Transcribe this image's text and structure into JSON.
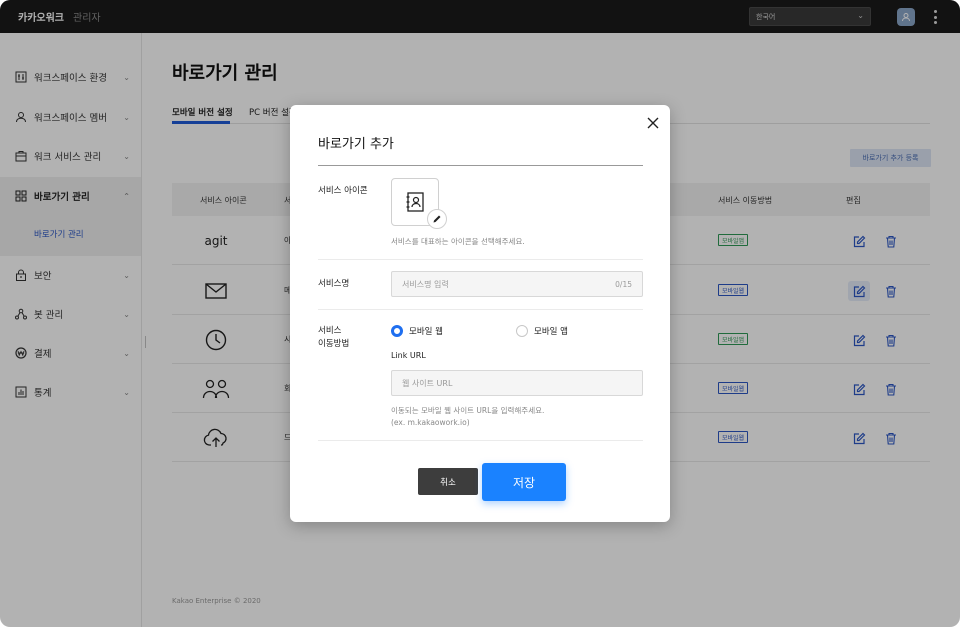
{
  "app": {
    "brand": "카카오워크",
    "brand_sub": "관리자"
  },
  "topbar": {
    "language": "한국어"
  },
  "sidebar": {
    "items": [
      {
        "label": "워크스페이스 환경",
        "icon": "sliders-icon"
      },
      {
        "label": "워크스페이스 멤버",
        "icon": "person-icon"
      },
      {
        "label": "워크 서비스 관리",
        "icon": "briefcase-icon"
      },
      {
        "label": "바로가기 관리",
        "icon": "grid-icon",
        "active": true
      },
      {
        "label": "보안",
        "icon": "lock-icon"
      },
      {
        "label": "봇 관리",
        "icon": "bot-icon"
      },
      {
        "label": "결제",
        "icon": "won-icon"
      },
      {
        "label": "통계",
        "icon": "chart-icon"
      }
    ],
    "sub_item": "바로가기 관리"
  },
  "main": {
    "title": "바로가기 관리",
    "tabs": [
      {
        "label": "모바일 버전 설정"
      },
      {
        "label": "PC 버전 설정"
      }
    ],
    "register_button": "바로가기 추가 등록",
    "columns": {
      "icon": "서비스 아이콘",
      "name": "서",
      "method": "서비스 이동방법",
      "edit": "편집"
    },
    "rows": [
      {
        "icon": "agit-logo",
        "icon_text": "agit",
        "name": "아",
        "method": "모바일앱",
        "kind": "app"
      },
      {
        "icon": "mail-icon",
        "icon_text": "",
        "name": "메",
        "method": "모바일웹",
        "kind": "web"
      },
      {
        "icon": "clock-icon",
        "icon_text": "",
        "name": "시",
        "method": "모바일앱",
        "kind": "app"
      },
      {
        "icon": "people-icon",
        "icon_text": "",
        "name": "회",
        "method": "모바일웹",
        "kind": "web"
      },
      {
        "icon": "cloud-upload-icon",
        "icon_text": "",
        "name": "드",
        "method": "모바일웹",
        "kind": "web"
      }
    ],
    "footer": "Kakao Enterprise © 2020"
  },
  "modal": {
    "title": "바로가기 추가",
    "service_icon_label": "서비스 아이콘",
    "service_icon_hint": "서비스를 대표하는 아이콘을 선택해주세요.",
    "service_name_label": "서비스명",
    "service_name_placeholder": "서비스명 입력",
    "service_name_counter": "0/15",
    "method_label_1": "서비스",
    "method_label_2": "이동방법",
    "radio_web": "모바일 웹",
    "radio_app": "모바일 앱",
    "link_url_label": "Link URL",
    "link_url_placeholder": "웹 사이트 URL",
    "link_hint_1": "이동되는 모바일 웹 사이트 URL을 입력해주세요.",
    "link_hint_2": "(ex. m.kakaowork.io)",
    "cancel": "취소",
    "save": "저장"
  }
}
